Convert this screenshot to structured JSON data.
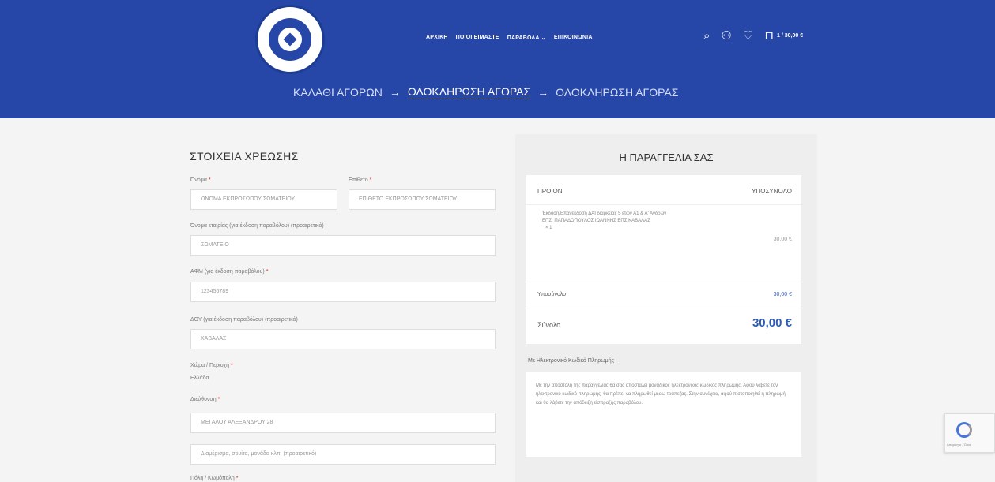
{
  "header": {
    "nav": [
      "ΑΡΧΙΚΗ",
      "ΠΟΙΟΙ ΕΙΜΑΣΤΕ",
      "ΠΑΡΑΒΟΛΑ ⌄",
      "ΕΠΙΚΟΙΝΩΝΙΑ"
    ],
    "cart_total": "1 / 30,00 €"
  },
  "steps": {
    "cart": "ΚΑΛΑΘΙ ΑΓΟΡΩΝ",
    "checkout": "ΟΛΟΚΛΗΡΩΣΗ ΑΓΟΡΑΣ",
    "complete": "ΟΛΟΚΛΗΡΩΣΗ ΑΓΟΡΑΣ",
    "arrow": "→"
  },
  "billing": {
    "title": "ΣΤΟΙΧΕΙΑ ΧΡΕΩΣΗΣ",
    "first_name_label": "Όνομα",
    "first_name_value": "ΟΝΟΜΑ ΕΚΠΡΟΣΩΠΟΥ ΣΩΜΑΤΕΙΟΥ",
    "last_name_label": "Επίθετο",
    "last_name_value": "ΕΠΙΘΕΤΟ ΕΚΠΡΟΣΩΠΟΥ ΣΩΜΑΤΕΙΟΥ",
    "company_label": "Όνομα εταιρίας (για έκδοση παραβόλου) (προαιρετικό)",
    "company_value": "ΣΩΜΑΤΕΙΟ",
    "afm_label": "ΑΦΜ (για έκδοση παραβόλου)",
    "afm_value": "123456789",
    "doy_label": "ΔΟΥ (για έκδοση παραβόλου) (προαιρετικό)",
    "doy_value": "ΚΑΒΑΛΑΣ",
    "country_label": "Χώρα / Περιοχή",
    "country_value": "Ελλάδα",
    "address_label": "Διεύθυνση",
    "address_value": "ΜΕΓΑΛΟΥ ΑΛΕΞΑΝΔΡΟΥ 28",
    "address2_placeholder": "Διαμέρισμα, σουίτα, μονάδα κλπ. (προαιρετικό)",
    "city_label": "Πόλη / Κωμόπολη",
    "required_mark": "*"
  },
  "order": {
    "title": "Η ΠΑΡΑΓΓΕΛΙΑ ΣΑΣ",
    "col_product": "ΠΡΟΙΟΝ",
    "col_subtotal": "ΥΠΟΣΥΝΟΛΟ",
    "product_name": "Έκδοση/Επανέκδοση ΔΑΙ διάρκειας 5 ετών Α1 & Α' Ανδρών ΕΠΣ: ΠΑΠΑΔΟΠΟΥΛΟΣ ΙΩΑΝΝΗΣ ΕΠΣ ΚΑΒΑΛΑΣ",
    "product_qty": "× 1",
    "product_price": "30,00 €",
    "subtotal_label": "Υποσύνολο",
    "subtotal_value": "30,00 €",
    "total_label": "Σύνολο",
    "total_value": "30,00 €"
  },
  "payment": {
    "title": "Με Ηλεκτρονικό Κωδικό Πληρωμής",
    "description": "Με την αποστολή της παραγγελίας θα σας αποσταλεί μοναδικός ηλεκτρονικός κωδικός πληρωμής. Αφού λάβετε τον ηλεκτρονικό κωδικό πληρωμής, θα πρέπει να πληρωθεί μέσω τράπεζας. Στην συνέχεια, αφού πιστοποιηθεί η πληρωμή και θα λάβετε την απόδειξη είσπραξης παραβόλου."
  },
  "recaptcha": {
    "text": "Απόρρητο - Όροι"
  }
}
